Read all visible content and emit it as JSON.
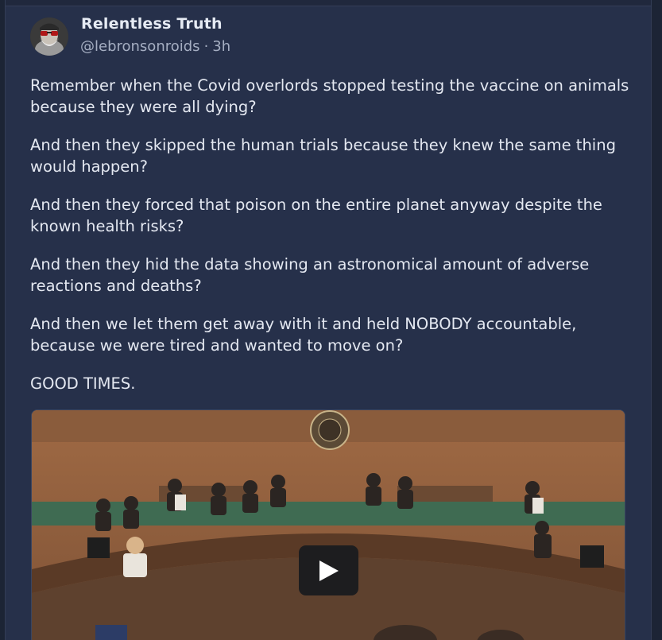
{
  "post": {
    "display_name": "Relentless Truth",
    "handle": "@lebronsonroids",
    "separator": "·",
    "time": "3h",
    "paragraphs": [
      "Remember when the Covid overlords stopped testing the vaccine on animals because they were all dying?",
      "And then they skipped the human trials because they knew the same thing would happen?",
      "And then they forced that poison on the entire planet anyway despite the known health risks?",
      "And then they hid the data showing an astronomical amount of adverse reactions and deaths?",
      "And then we let them get away with it and held NOBODY accountable, because we were tired and wanted to move on?",
      "GOOD TIMES."
    ],
    "media": {
      "type": "video",
      "play_icon": "play-icon"
    }
  },
  "colors": {
    "background": "#26304a",
    "text": "#e4e8f1",
    "muted": "#a5aec2"
  }
}
